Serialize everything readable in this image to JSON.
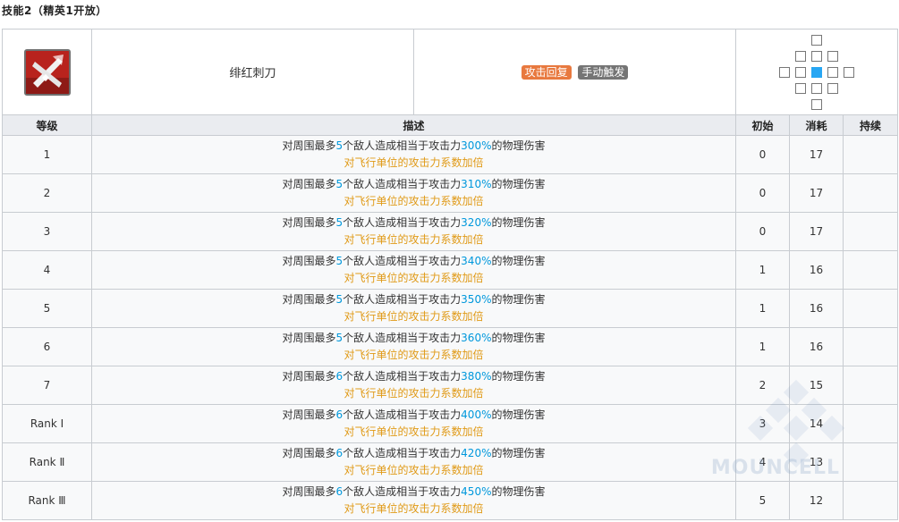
{
  "section_title": "技能2（精英1开放）",
  "skill": {
    "icon": "crimson-blade-icon",
    "name": "绯红刺刀",
    "tags": [
      {
        "label": "攻击回复",
        "color": "#e8793f"
      },
      {
        "label": "手动触发",
        "color": "#757575"
      }
    ]
  },
  "range": {
    "cells": [
      [
        0,
        -2
      ],
      [
        -1,
        -1
      ],
      [
        0,
        -1
      ],
      [
        1,
        -1
      ],
      [
        -2,
        0
      ],
      [
        -1,
        0
      ],
      [
        0,
        0
      ],
      [
        1,
        0
      ],
      [
        2,
        0
      ],
      [
        -1,
        1
      ],
      [
        0,
        1
      ],
      [
        1,
        1
      ],
      [
        0,
        2
      ]
    ],
    "self_cell": [
      0,
      0
    ],
    "self_color": "#27a6f3"
  },
  "columns": {
    "level": "等级",
    "description": "描述",
    "initial": "初始",
    "cost": "消耗",
    "duration": "持续"
  },
  "levels": [
    {
      "level": "1",
      "pre": "对周围最多",
      "count": "5",
      "mid": "个敌人造成相当于攻击力",
      "pct": "300%",
      "post": "的物理伤害",
      "note": "对飞行单位的攻击力系数加倍",
      "initial": "0",
      "cost": "17",
      "duration": ""
    },
    {
      "level": "2",
      "pre": "对周围最多",
      "count": "5",
      "mid": "个敌人造成相当于攻击力",
      "pct": "310%",
      "post": "的物理伤害",
      "note": "对飞行单位的攻击力系数加倍",
      "initial": "0",
      "cost": "17",
      "duration": ""
    },
    {
      "level": "3",
      "pre": "对周围最多",
      "count": "5",
      "mid": "个敌人造成相当于攻击力",
      "pct": "320%",
      "post": "的物理伤害",
      "note": "对飞行单位的攻击力系数加倍",
      "initial": "0",
      "cost": "17",
      "duration": ""
    },
    {
      "level": "4",
      "pre": "对周围最多",
      "count": "5",
      "mid": "个敌人造成相当于攻击力",
      "pct": "340%",
      "post": "的物理伤害",
      "note": "对飞行单位的攻击力系数加倍",
      "initial": "1",
      "cost": "16",
      "duration": ""
    },
    {
      "level": "5",
      "pre": "对周围最多",
      "count": "5",
      "mid": "个敌人造成相当于攻击力",
      "pct": "350%",
      "post": "的物理伤害",
      "note": "对飞行单位的攻击力系数加倍",
      "initial": "1",
      "cost": "16",
      "duration": ""
    },
    {
      "level": "6",
      "pre": "对周围最多",
      "count": "5",
      "mid": "个敌人造成相当于攻击力",
      "pct": "360%",
      "post": "的物理伤害",
      "note": "对飞行单位的攻击力系数加倍",
      "initial": "1",
      "cost": "16",
      "duration": ""
    },
    {
      "level": "7",
      "pre": "对周围最多",
      "count": "6",
      "mid": "个敌人造成相当于攻击力",
      "pct": "380%",
      "post": "的物理伤害",
      "note": "对飞行单位的攻击力系数加倍",
      "initial": "2",
      "cost": "15",
      "duration": ""
    },
    {
      "level": "Rank Ⅰ",
      "pre": "对周围最多",
      "count": "6",
      "mid": "个敌人造成相当于攻击力",
      "pct": "400%",
      "post": "的物理伤害",
      "note": "对飞行单位的攻击力系数加倍",
      "initial": "3",
      "cost": "14",
      "duration": ""
    },
    {
      "level": "Rank Ⅱ",
      "pre": "对周围最多",
      "count": "6",
      "mid": "个敌人造成相当于攻击力",
      "pct": "420%",
      "post": "的物理伤害",
      "note": "对飞行单位的攻击力系数加倍",
      "initial": "4",
      "cost": "13",
      "duration": ""
    },
    {
      "level": "Rank Ⅲ",
      "pre": "对周围最多",
      "count": "6",
      "mid": "个敌人造成相当于攻击力",
      "pct": "450%",
      "post": "的物理伤害",
      "note": "对飞行单位的攻击力系数加倍",
      "initial": "5",
      "cost": "12",
      "duration": ""
    }
  ],
  "watermark": "MOUNCELL"
}
